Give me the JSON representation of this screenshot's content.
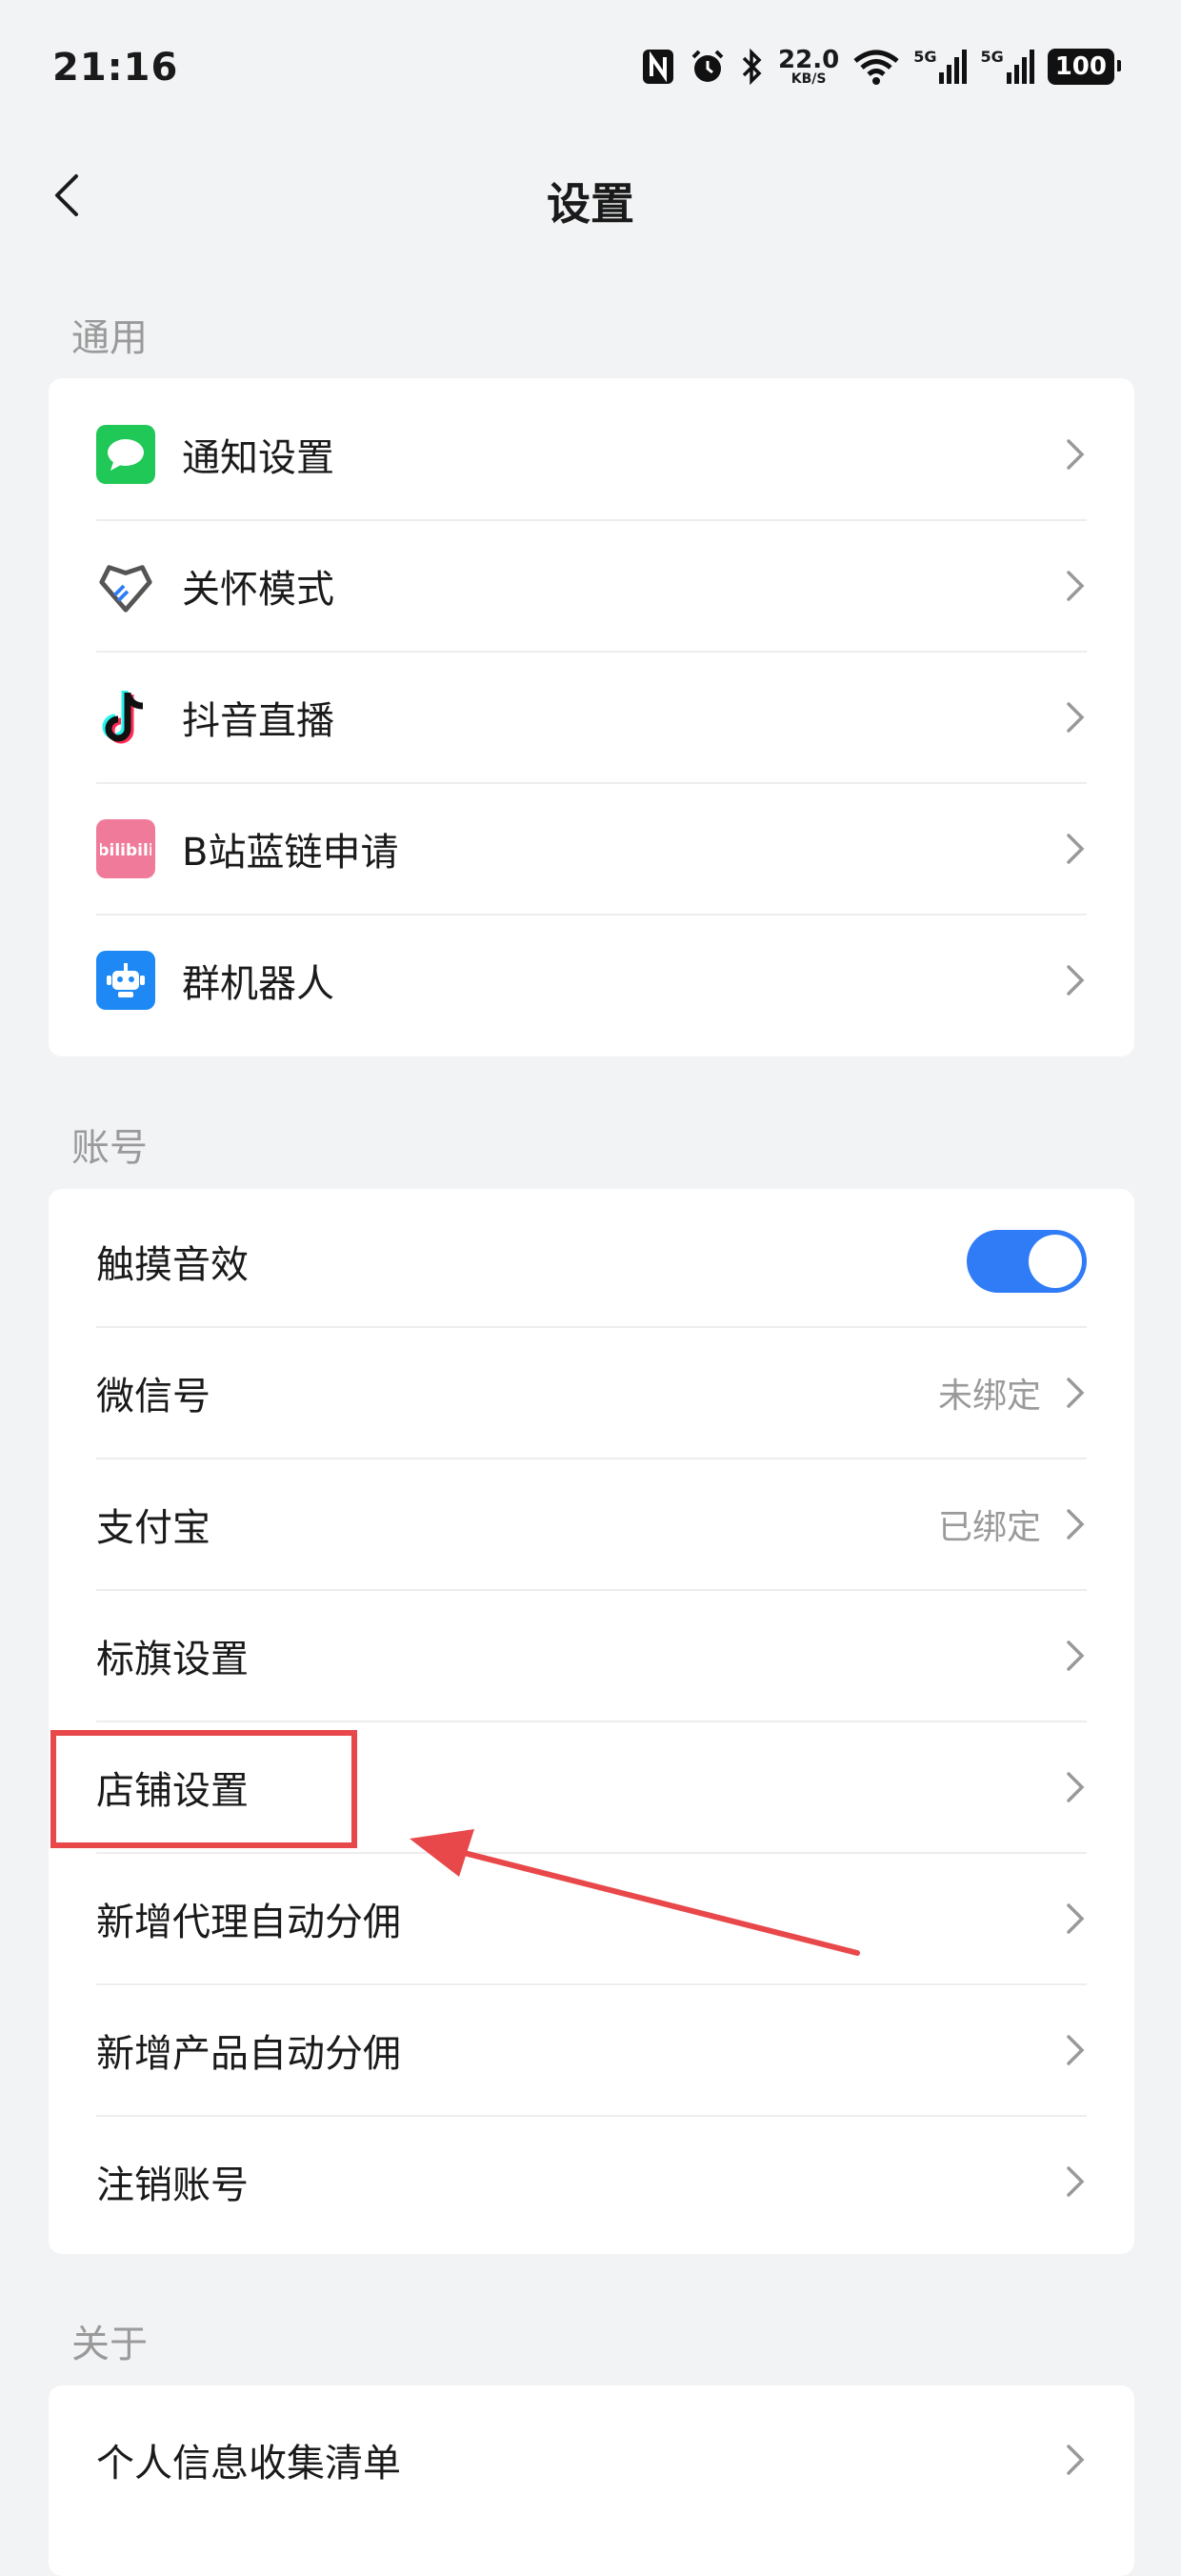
{
  "status_bar": {
    "time": "21:16",
    "network_speed": "22.0",
    "network_speed_unit": "KB/S",
    "signal1_label": "5G",
    "signal2_label": "5G",
    "battery": "100"
  },
  "nav": {
    "title": "设置"
  },
  "sections": {
    "general": {
      "label": "通用",
      "items": [
        {
          "label": "通知设置",
          "icon": "chat-bubble-icon",
          "color": "#20c857"
        },
        {
          "label": "关怀模式",
          "icon": "heart-care-icon",
          "color": "#555555"
        },
        {
          "label": "抖音直播",
          "icon": "tiktok-icon",
          "color": "#000000"
        },
        {
          "label": "B站蓝链申请",
          "icon": "bilibili-icon",
          "color": "#f07a9a"
        },
        {
          "label": "群机器人",
          "icon": "robot-icon",
          "color": "#1e88f5"
        }
      ]
    },
    "account": {
      "label": "账号",
      "items": [
        {
          "label": "触摸音效",
          "toggle": true
        },
        {
          "label": "微信号",
          "value": "未绑定"
        },
        {
          "label": "支付宝",
          "value": "已绑定"
        },
        {
          "label": "标旗设置"
        },
        {
          "label": "店铺设置"
        },
        {
          "label": "新增代理自动分佣"
        },
        {
          "label": "新增产品自动分佣"
        },
        {
          "label": "注销账号"
        }
      ]
    },
    "about": {
      "label": "关于",
      "items": [
        {
          "label": "个人信息收集清单"
        }
      ]
    }
  },
  "colors": {
    "accent": "#2f7cf6",
    "annotation": "#e8484a",
    "background": "#f2f3f5"
  }
}
